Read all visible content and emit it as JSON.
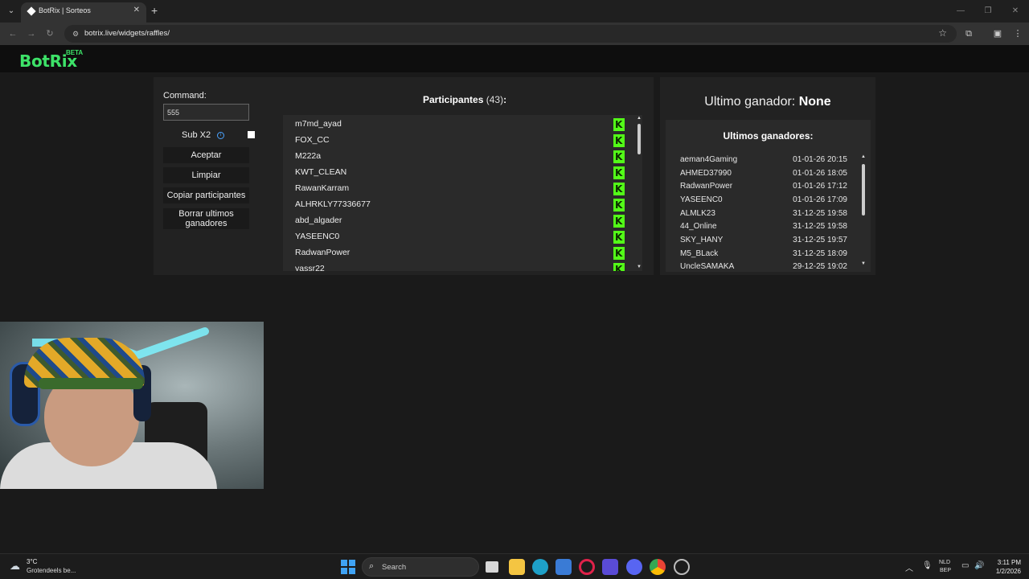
{
  "browser": {
    "tab_title": "BotRix | Sorteos",
    "url": "botrix.live/widgets/raffles/"
  },
  "site": {
    "logo": "BotRix",
    "beta": "BETA"
  },
  "controls": {
    "command_label": "Command:",
    "command_value": "555",
    "subx2_label": "Sub X2",
    "subx2_checked": false,
    "accept_label": "Aceptar",
    "clear_label": "Limpiar",
    "copy_label": "Copiar participantes",
    "delete_line1": "Borrar ultimos",
    "delete_line2": "ganadores"
  },
  "participants": {
    "title": "Participantes",
    "count": "(43)",
    "colon": ":",
    "items": [
      "m7md_ayad",
      "FOX_CC",
      "M222a",
      "KWT_CLEAN",
      "RawanKarram",
      "ALHRKLY77336677",
      "abd_algader",
      "YASEENC0",
      "RadwanPower",
      "yassr22"
    ]
  },
  "winners": {
    "last_label": "Ultimo ganador:",
    "last_value": "None",
    "list_title": "Ultimos ganadores:",
    "items": [
      {
        "name": "aeman4Gaming",
        "date": "01-01-26 20:15"
      },
      {
        "name": "AHMED37990",
        "date": "01-01-26 18:05"
      },
      {
        "name": "RadwanPower",
        "date": "01-01-26 17:12"
      },
      {
        "name": "YASEENC0",
        "date": "01-01-26 17:09"
      },
      {
        "name": "ALMLK23",
        "date": "31-12-25 19:58"
      },
      {
        "name": "44_Online",
        "date": "31-12-25 19:58"
      },
      {
        "name": "SKY_HANY",
        "date": "31-12-25 19:57"
      },
      {
        "name": "M5_BLack",
        "date": "31-12-25 18:09"
      },
      {
        "name": "UncleSAMAKA",
        "date": "29-12-25 19:02"
      }
    ]
  },
  "taskbar": {
    "weather_temp": "3°C",
    "weather_desc": "Grotendeels be...",
    "search_placeholder": "Search",
    "lang_line1": "NLD",
    "lang_line2": "BEP",
    "time": "3:11 PM",
    "date": "1/2/2026"
  },
  "colors": {
    "brand_green": "#3de268",
    "kick_green": "#53fc18",
    "info_blue": "#4aa3ff"
  }
}
